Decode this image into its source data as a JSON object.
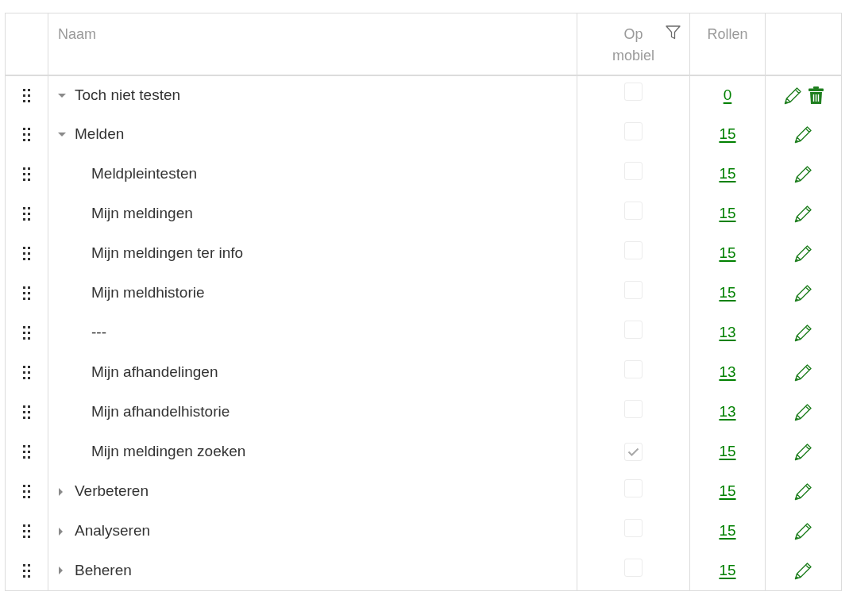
{
  "table": {
    "columns": [
      {
        "label": "Naam",
        "filterable": false
      },
      {
        "label": "Op mobiel",
        "filterable": true
      },
      {
        "label": "Rollen",
        "filterable": false
      }
    ],
    "rows": [
      {
        "name": "Toch niet testen",
        "expanded": true,
        "on_mobile": false,
        "roles": "0",
        "deletable": true
      },
      {
        "name": "Melden",
        "expanded": true,
        "on_mobile": false,
        "roles": "15",
        "deletable": false,
        "children": [
          {
            "name": "Meldpleintesten",
            "on_mobile": false,
            "roles": "15",
            "deletable": false
          },
          {
            "name": "Mijn meldingen",
            "on_mobile": false,
            "roles": "15",
            "deletable": false
          },
          {
            "name": "Mijn meldingen ter info",
            "on_mobile": false,
            "roles": "15",
            "deletable": false
          },
          {
            "name": "Mijn meldhistorie",
            "on_mobile": false,
            "roles": "15",
            "deletable": false
          },
          {
            "name": "---",
            "on_mobile": false,
            "roles": "13",
            "deletable": false
          },
          {
            "name": "Mijn afhandelingen",
            "on_mobile": false,
            "roles": "13",
            "deletable": false
          },
          {
            "name": "Mijn afhandelhistorie",
            "on_mobile": false,
            "roles": "13",
            "deletable": false
          },
          {
            "name": "Mijn meldingen zoeken",
            "on_mobile": true,
            "roles": "15",
            "deletable": false
          }
        ]
      },
      {
        "name": "Verbeteren",
        "expanded": false,
        "on_mobile": false,
        "roles": "15",
        "deletable": false
      },
      {
        "name": "Analyseren",
        "expanded": false,
        "on_mobile": false,
        "roles": "15",
        "deletable": false
      },
      {
        "name": "Beheren",
        "expanded": false,
        "on_mobile": false,
        "roles": "15",
        "deletable": false
      }
    ]
  }
}
